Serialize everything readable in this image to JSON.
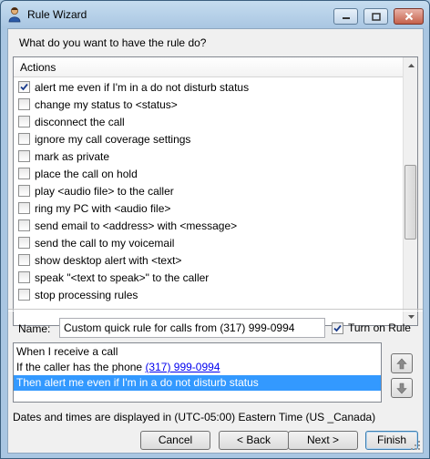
{
  "window": {
    "title": "Rule Wizard"
  },
  "prompt": "What do you want to have the rule do?",
  "actions": {
    "header": "Actions",
    "items": [
      {
        "label": "alert me even if I'm in a do not disturb status",
        "checked": true
      },
      {
        "label": "change my status to <status>",
        "checked": false
      },
      {
        "label": "disconnect the call",
        "checked": false
      },
      {
        "label": "ignore my call coverage settings",
        "checked": false
      },
      {
        "label": "mark as private",
        "checked": false
      },
      {
        "label": "place the call on hold",
        "checked": false
      },
      {
        "label": "play <audio file> to the caller",
        "checked": false
      },
      {
        "label": "ring my PC with <audio file>",
        "checked": false
      },
      {
        "label": "send email to <address> with <message>",
        "checked": false
      },
      {
        "label": "send the call to my voicemail",
        "checked": false
      },
      {
        "label": "show desktop alert with <text>",
        "checked": false
      },
      {
        "label": "speak \"<text to speak>\" to the caller",
        "checked": false
      },
      {
        "label": "stop processing rules",
        "checked": false
      }
    ]
  },
  "name_field": {
    "label": "Name:",
    "value": "Custom quick rule for calls from (317) 999-0994"
  },
  "turn_on": {
    "label": "Turn on Rule",
    "checked": true
  },
  "description": {
    "line1": "When I receive a call",
    "line2_prefix": "If the caller has the phone ",
    "line2_link": "(317) 999-0994",
    "line3": "Then alert me even if I'm in a do not disturb status"
  },
  "timezone_note": "Dates and times are displayed in (UTC-05:00) Eastern Time (US _Canada)",
  "buttons": {
    "cancel": "Cancel",
    "back": "< Back",
    "next": "Next >",
    "finish": "Finish"
  },
  "icons": {
    "app": "person-icon",
    "minimize": "minimize-icon",
    "maximize": "maximize-icon",
    "close": "close-icon",
    "move_up": "arrow-up-icon",
    "move_down": "arrow-down-icon"
  },
  "colors": {
    "selection": "#3399ff",
    "link": "#0000ee",
    "close_button": "#c5614b"
  }
}
